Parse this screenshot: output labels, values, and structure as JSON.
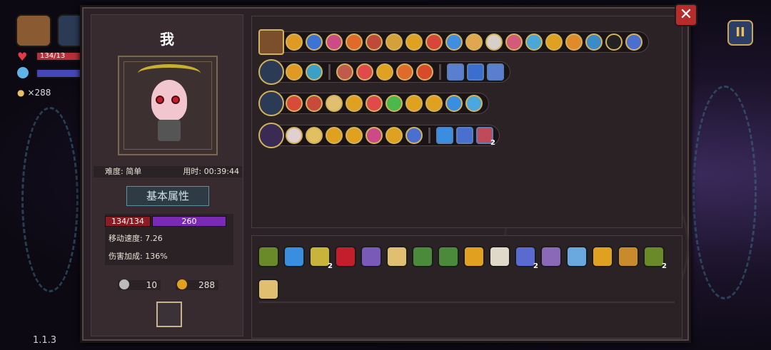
{
  "hud": {
    "hp_text": "134/13",
    "coin_text": "×288"
  },
  "version": "1.1.3",
  "buttons": {
    "close": "✕",
    "pause": "II"
  },
  "player": {
    "name": "我",
    "difficulty": "难度: 简单",
    "time": "用时: 00:39:44",
    "section_title": "基本属性",
    "hp": "134/134",
    "mp": "260",
    "move_speed": "移动速度: 7.26",
    "damage_bonus": "伤害加成: 136%",
    "keys": "10",
    "coins": "288"
  },
  "colors": {
    "panel": "#2b2126",
    "accent_gold": "#d2b25a",
    "hp": "#b5303b",
    "mp": "#7a2bb5"
  },
  "loadout_rows": [
    {
      "main_icon": "chest-icon",
      "main_color": "#7b4e2c",
      "square": true,
      "icons": [
        "#e09a24",
        "#3b74d6",
        "#cc4a86",
        "#e06a2a",
        "#c04a3a",
        "#d4a03a",
        "#e0a020",
        "#d8453a",
        "#3f8ee0",
        "#e0a650",
        "#d7d0c8",
        "#d45a7a",
        "#4aa7d8",
        "#e0a020",
        "#e08a2a",
        "#3a8bc8",
        "#222222",
        "#4a6fd0"
      ],
      "groups": [
        18
      ],
      "badges": {}
    },
    {
      "main_icon": "hammer-icon",
      "main_color": "#2b3b55",
      "icons": [
        "#e09a24",
        "#3aa0c8",
        "#c05a4a",
        "#e04a4a",
        "#e0a020",
        "#e06a2a",
        "#d84a2a",
        "#5a7fd0",
        "#3a6fd0",
        "#5a7fd0"
      ],
      "groups": [
        2,
        5,
        3
      ],
      "badges": {}
    },
    {
      "main_icon": "staff-blue-icon",
      "main_color": "#2b3b55",
      "icons": [
        "#d84a3a",
        "#c84a3a",
        "#e0c070",
        "#e0a020",
        "#e04a4a",
        "#4ab84a",
        "#e0a020",
        "#e0a020",
        "#3a8ee0",
        "#4aa7e0"
      ],
      "groups": [
        10
      ],
      "badges": {}
    },
    {
      "main_icon": "staff-red-icon",
      "main_color": "#3a2b55",
      "icons": [
        "#e0d0d0",
        "#e0c060",
        "#e0a020",
        "#e0a020",
        "#cc4a86",
        "#e0a020",
        "#4a6fd0",
        "#3a8ee0",
        "#4a6fd0",
        "#c04a5a"
      ],
      "groups": [
        7,
        3
      ],
      "badges": {
        "9": "2"
      }
    }
  ],
  "inventory": [
    {
      "icon": "vine-icon",
      "color": "#6a8a2a",
      "count": ""
    },
    {
      "icon": "ring-icon",
      "color": "#3a8ee0",
      "count": ""
    },
    {
      "icon": "feather-icon",
      "color": "#c8b43a",
      "count": "2"
    },
    {
      "icon": "eye-red-icon",
      "color": "#c41d2b",
      "count": ""
    },
    {
      "icon": "rune-icon",
      "color": "#7a5ab8",
      "count": ""
    },
    {
      "icon": "wing-icon",
      "color": "#e0c070",
      "count": ""
    },
    {
      "icon": "boot-icon",
      "color": "#4a8a3a",
      "count": ""
    },
    {
      "icon": "helmet-icon",
      "color": "#4a8a3a",
      "count": ""
    },
    {
      "icon": "chalice-icon",
      "color": "#e0a020",
      "count": ""
    },
    {
      "icon": "teeth-icon",
      "color": "#e0d8c8",
      "count": ""
    },
    {
      "icon": "idol-icon",
      "color": "#5a6ad0",
      "count": "2"
    },
    {
      "icon": "potion-icon",
      "color": "#8a6ab8",
      "count": ""
    },
    {
      "icon": "lotus-icon",
      "color": "#6aa8e0",
      "count": ""
    },
    {
      "icon": "key-icon",
      "color": "#e0a020",
      "count": ""
    },
    {
      "icon": "pickaxe-icon",
      "color": "#c88a2a",
      "count": ""
    },
    {
      "icon": "snake-icon",
      "color": "#6a8a2a",
      "count": "2"
    },
    {
      "icon": "cage-icon",
      "color": "#e0c070",
      "count": ""
    }
  ]
}
